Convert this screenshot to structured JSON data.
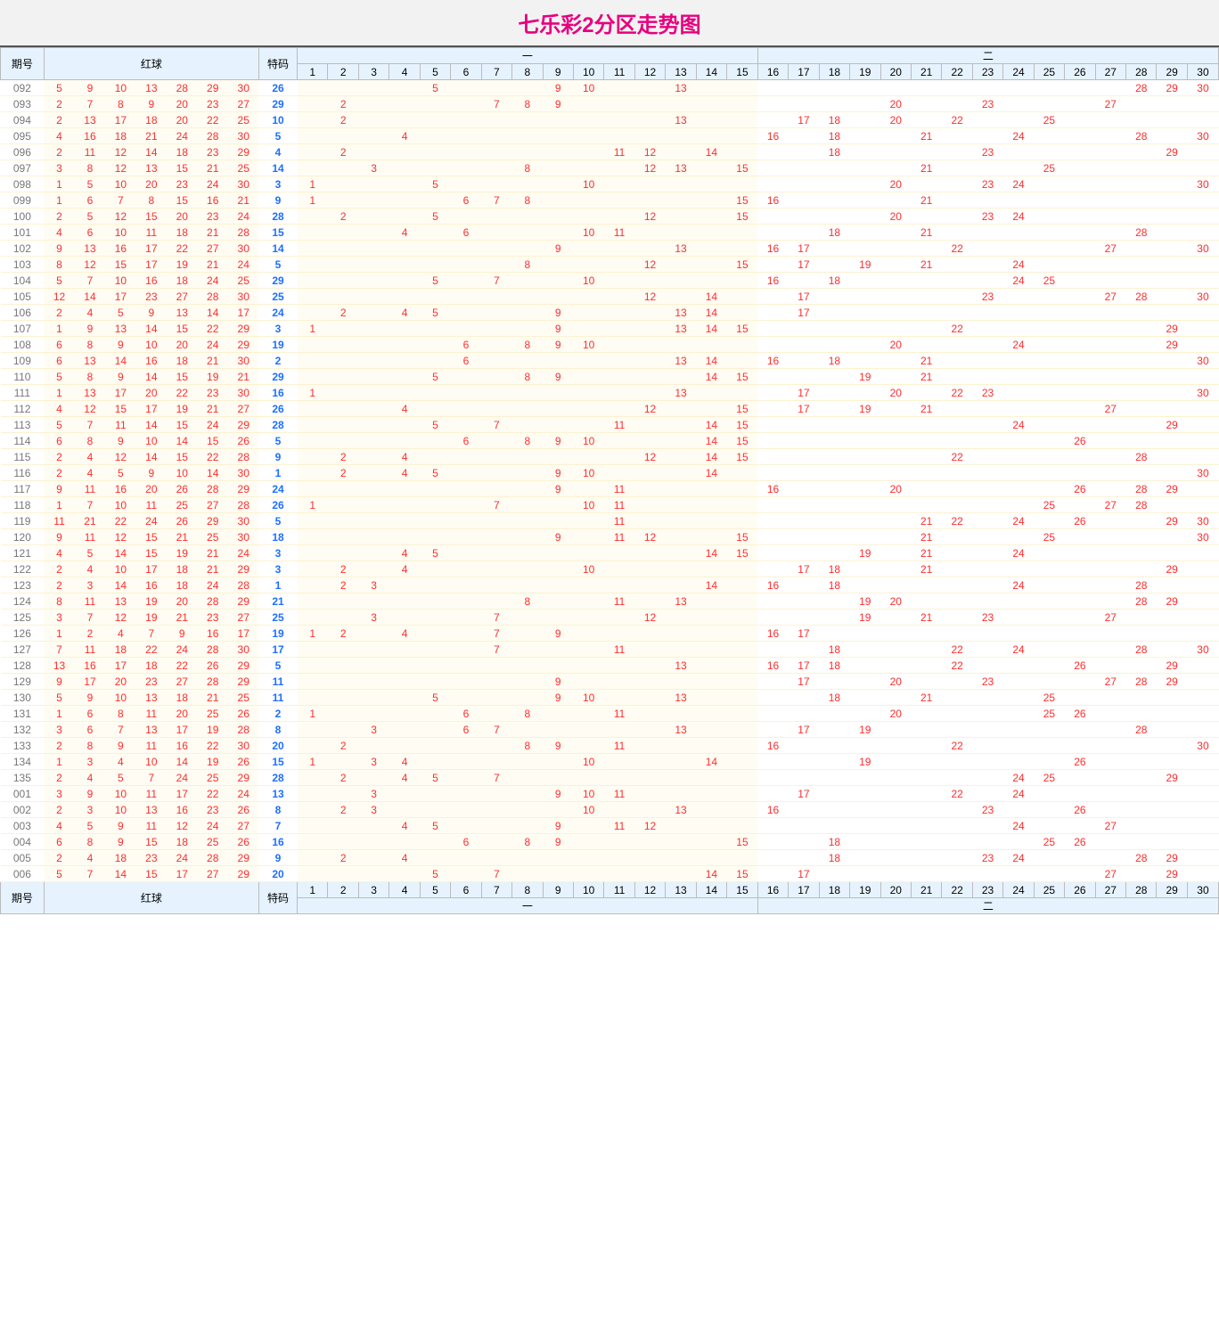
{
  "title": "七乐彩2分区走势图",
  "headers": {
    "period": "期号",
    "redball": "红球",
    "special": "特码",
    "zone1": "一",
    "zone2": "二"
  },
  "numbers": [
    1,
    2,
    3,
    4,
    5,
    6,
    7,
    8,
    9,
    10,
    11,
    12,
    13,
    14,
    15,
    16,
    17,
    18,
    19,
    20,
    21,
    22,
    23,
    24,
    25,
    26,
    27,
    28,
    29,
    30
  ],
  "chart_data": {
    "type": "table",
    "description": "七乐彩 lottery trend chart, 2-zone partition. Columns 1-15 = zone 一, 16-30 = zone 二. Each row: period id, 7 red balls, 1 special code, then marks in the 30 number columns for balls that fall in that zone.",
    "rows": [
      {
        "period": "092",
        "balls": [
          5,
          9,
          10,
          13,
          28,
          29,
          30
        ],
        "sp": 26
      },
      {
        "period": "093",
        "balls": [
          2,
          7,
          8,
          9,
          20,
          23,
          27
        ],
        "sp": 29
      },
      {
        "period": "094",
        "balls": [
          2,
          13,
          17,
          18,
          20,
          22,
          25
        ],
        "sp": 10
      },
      {
        "period": "095",
        "balls": [
          4,
          16,
          18,
          21,
          24,
          28,
          30
        ],
        "sp": 5
      },
      {
        "period": "096",
        "balls": [
          2,
          11,
          12,
          14,
          18,
          23,
          29
        ],
        "sp": 4
      },
      {
        "period": "097",
        "balls": [
          3,
          8,
          12,
          13,
          15,
          21,
          25
        ],
        "sp": 14
      },
      {
        "period": "098",
        "balls": [
          1,
          5,
          10,
          20,
          23,
          24,
          30
        ],
        "sp": 3
      },
      {
        "period": "099",
        "balls": [
          1,
          6,
          7,
          8,
          15,
          16,
          21
        ],
        "sp": 9
      },
      {
        "period": "100",
        "balls": [
          2,
          5,
          12,
          15,
          20,
          23,
          24
        ],
        "sp": 28
      },
      {
        "period": "101",
        "balls": [
          4,
          6,
          10,
          11,
          18,
          21,
          28
        ],
        "sp": 15
      },
      {
        "period": "102",
        "balls": [
          9,
          13,
          16,
          17,
          22,
          27,
          30
        ],
        "sp": 14
      },
      {
        "period": "103",
        "balls": [
          8,
          12,
          15,
          17,
          19,
          21,
          24
        ],
        "sp": 5
      },
      {
        "period": "104",
        "balls": [
          5,
          7,
          10,
          16,
          18,
          24,
          25
        ],
        "sp": 29
      },
      {
        "period": "105",
        "balls": [
          12,
          14,
          17,
          23,
          27,
          28,
          30
        ],
        "sp": 25
      },
      {
        "period": "106",
        "balls": [
          2,
          4,
          5,
          9,
          13,
          14,
          17
        ],
        "sp": 24
      },
      {
        "period": "107",
        "balls": [
          1,
          9,
          13,
          14,
          15,
          22,
          29
        ],
        "sp": 3
      },
      {
        "period": "108",
        "balls": [
          6,
          8,
          9,
          10,
          20,
          24,
          29
        ],
        "sp": 19
      },
      {
        "period": "109",
        "balls": [
          6,
          13,
          14,
          16,
          18,
          21,
          30
        ],
        "sp": 2
      },
      {
        "period": "110",
        "balls": [
          5,
          8,
          9,
          14,
          15,
          19,
          21
        ],
        "sp": 29
      },
      {
        "period": "111",
        "balls": [
          1,
          13,
          17,
          20,
          22,
          23,
          30
        ],
        "sp": 16
      },
      {
        "period": "112",
        "balls": [
          4,
          12,
          15,
          17,
          19,
          21,
          27
        ],
        "sp": 26
      },
      {
        "period": "113",
        "balls": [
          5,
          7,
          11,
          14,
          15,
          24,
          29
        ],
        "sp": 28
      },
      {
        "period": "114",
        "balls": [
          6,
          8,
          9,
          10,
          14,
          15,
          26
        ],
        "sp": 5
      },
      {
        "period": "115",
        "balls": [
          2,
          4,
          12,
          14,
          15,
          22,
          28
        ],
        "sp": 9
      },
      {
        "period": "116",
        "balls": [
          2,
          4,
          5,
          9,
          10,
          14,
          30
        ],
        "sp": 1
      },
      {
        "period": "117",
        "balls": [
          9,
          11,
          16,
          20,
          26,
          28,
          29
        ],
        "sp": 24
      },
      {
        "period": "118",
        "balls": [
          1,
          7,
          10,
          11,
          25,
          27,
          28
        ],
        "sp": 26
      },
      {
        "period": "119",
        "balls": [
          11,
          21,
          22,
          24,
          26,
          29,
          30
        ],
        "sp": 5
      },
      {
        "period": "120",
        "balls": [
          9,
          11,
          12,
          15,
          21,
          25,
          30
        ],
        "sp": 18
      },
      {
        "period": "121",
        "balls": [
          4,
          5,
          14,
          15,
          19,
          21,
          24
        ],
        "sp": 3
      },
      {
        "period": "122",
        "balls": [
          2,
          4,
          10,
          17,
          18,
          21,
          29
        ],
        "sp": 3
      },
      {
        "period": "123",
        "balls": [
          2,
          3,
          14,
          16,
          18,
          24,
          28
        ],
        "sp": 1
      },
      {
        "period": "124",
        "balls": [
          8,
          11,
          13,
          19,
          20,
          28,
          29
        ],
        "sp": 21
      },
      {
        "period": "125",
        "balls": [
          3,
          7,
          12,
          19,
          21,
          23,
          27
        ],
        "sp": 25
      },
      {
        "period": "126",
        "balls": [
          1,
          2,
          4,
          7,
          9,
          16,
          17
        ],
        "sp": 19
      },
      {
        "period": "127",
        "balls": [
          7,
          11,
          18,
          22,
          24,
          28,
          30
        ],
        "sp": 17
      },
      {
        "period": "128",
        "balls": [
          13,
          16,
          17,
          18,
          22,
          26,
          29
        ],
        "sp": 5
      },
      {
        "period": "129",
        "balls": [
          17,
          20,
          23,
          27,
          28,
          29,
          9
        ],
        "sp": 11
      },
      {
        "period": "130",
        "balls": [
          5,
          9,
          10,
          13,
          18,
          21,
          25
        ],
        "sp": 11
      },
      {
        "period": "131",
        "balls": [
          1,
          6,
          8,
          11,
          20,
          25,
          26
        ],
        "sp": 2
      },
      {
        "period": "132",
        "balls": [
          3,
          6,
          7,
          13,
          17,
          19,
          28
        ],
        "sp": 8
      },
      {
        "period": "133",
        "balls": [
          2,
          8,
          9,
          11,
          16,
          22,
          30
        ],
        "sp": 20
      },
      {
        "period": "134",
        "balls": [
          1,
          3,
          4,
          10,
          14,
          19,
          26
        ],
        "sp": 15
      },
      {
        "period": "135",
        "balls": [
          2,
          4,
          5,
          7,
          24,
          25,
          29
        ],
        "sp": 28
      },
      {
        "period": "001",
        "balls": [
          3,
          9,
          10,
          11,
          17,
          22,
          24
        ],
        "sp": 13
      },
      {
        "period": "002",
        "balls": [
          2,
          3,
          10,
          13,
          16,
          23,
          26
        ],
        "sp": 8
      },
      {
        "period": "003",
        "balls": [
          4,
          5,
          9,
          11,
          12,
          24,
          27
        ],
        "sp": 7
      },
      {
        "period": "004",
        "balls": [
          6,
          8,
          9,
          15,
          18,
          25,
          26
        ],
        "sp": 16
      },
      {
        "period": "005",
        "balls": [
          2,
          4,
          18,
          23,
          24,
          28,
          29
        ],
        "sp": 9
      },
      {
        "period": "006",
        "balls": [
          5,
          7,
          14,
          15,
          17,
          27,
          29
        ],
        "sp": 20
      }
    ]
  }
}
